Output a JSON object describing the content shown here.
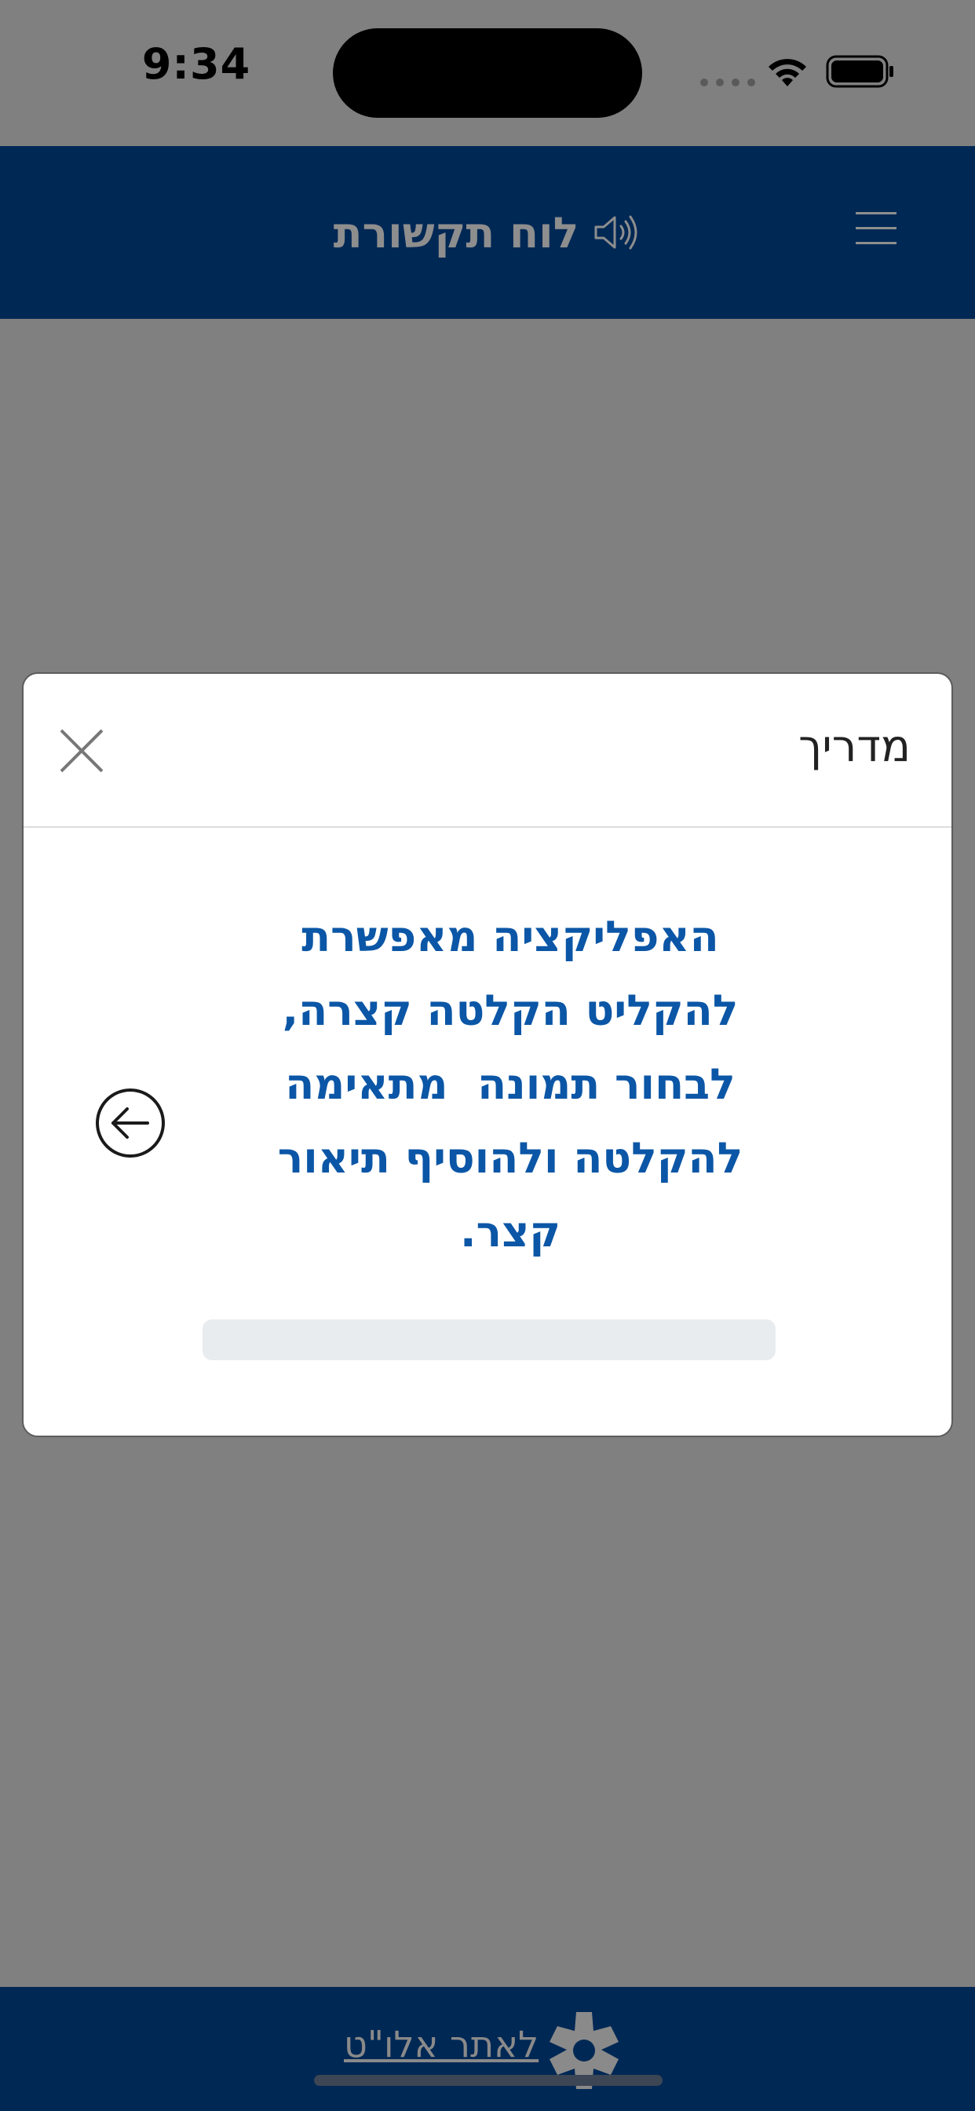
{
  "status_bar": {
    "time": "9:34"
  },
  "header": {
    "title": "לוח תקשורת",
    "speaker_icon": "speaker-icon",
    "menu_icon": "menu-icon"
  },
  "modal": {
    "title": "מדריך",
    "close_icon": "close-icon",
    "body_lines": [
      "האפליקציה מאפשרת",
      "להקליט הקלטה קצרה,",
      "לבחור תמונה  מתאימה",
      "להקלטה ולהוסיף תיאור",
      "קצר."
    ],
    "next_icon": "arrow-left-circle-icon",
    "progress": 0
  },
  "footer": {
    "link_label": "לאתר אלו\"ט",
    "logo_icon": "alut-logo-icon"
  },
  "colors": {
    "header_bg": "#002855",
    "overlay": "#808080",
    "body_text": "#0b56a6"
  }
}
